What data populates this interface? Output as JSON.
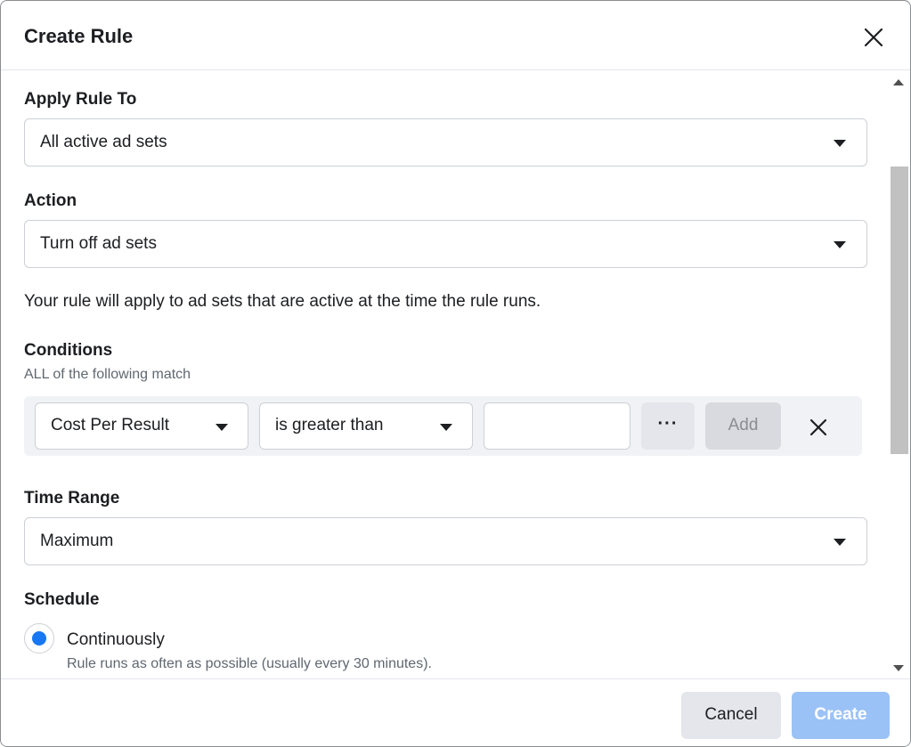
{
  "dialog": {
    "title": "Create Rule"
  },
  "apply_rule_to": {
    "label": "Apply Rule To",
    "value": "All active ad sets"
  },
  "action": {
    "label": "Action",
    "value": "Turn off ad sets"
  },
  "info_text": "Your rule will apply to ad sets that are active at the time the rule runs.",
  "conditions": {
    "label": "Conditions",
    "sublabel": "ALL of the following match",
    "metric": "Cost Per Result",
    "operator": "is greater than",
    "value": "",
    "more_label": "···",
    "add_label": "Add"
  },
  "time_range": {
    "label": "Time Range",
    "value": "Maximum"
  },
  "schedule": {
    "label": "Schedule",
    "option_label": "Continuously",
    "option_description": "Rule runs as often as possible (usually every 30 minutes)."
  },
  "footer": {
    "cancel_label": "Cancel",
    "create_label": "Create"
  },
  "colors": {
    "primary": "#1877f2",
    "primary_disabled": "#9bc2f7",
    "border": "#ccd0d5",
    "muted_text": "#606770"
  },
  "icons": {
    "close": "close-icon",
    "dropdown": "caret-down-icon",
    "more": "more-horizontal-icon",
    "remove": "close-icon"
  }
}
